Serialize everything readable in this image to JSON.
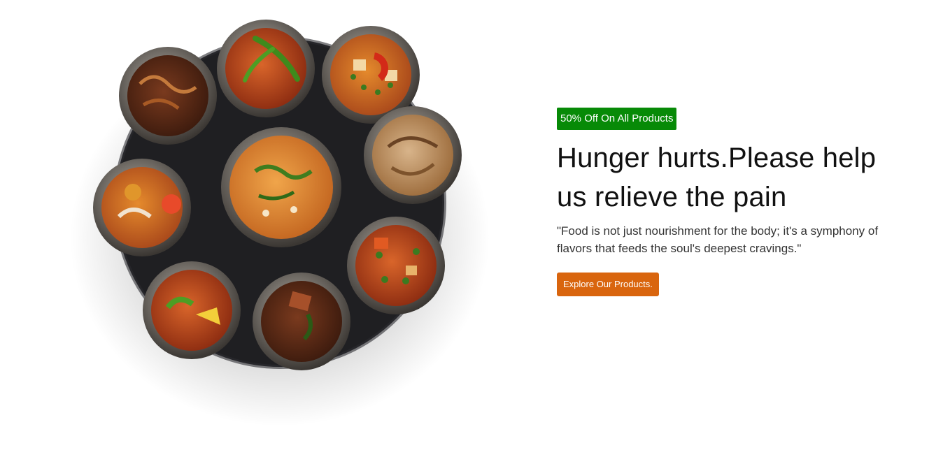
{
  "hero": {
    "badge": "50% Off On All Products",
    "headline": "Hunger hurts.Please help us relieve the pain",
    "quote": "\"Food is not just nourishment for the body; it's a symphony of flavors that feeds the soul's deepest cravings.\"",
    "cta_label": "Explore Our Products."
  },
  "colors": {
    "badge_bg": "#078a07",
    "cta_bg": "#d9650e",
    "platter": "#1f1f22"
  },
  "image": {
    "subject": "food-platter",
    "dishes": [
      "biryani",
      "curry-bowl",
      "curry-bowl",
      "curry-bowl",
      "curry-bowl",
      "curry-bowl",
      "curry-bowl",
      "curry-bowl",
      "curry-bowl"
    ]
  }
}
